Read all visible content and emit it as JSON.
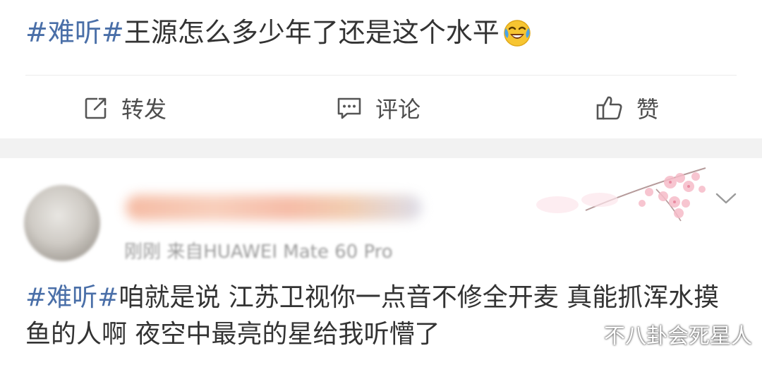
{
  "post": {
    "hashtag": "#难听#",
    "text": "王源怎么多少年了还是这个水平",
    "emoji_icon": "laughing-tears-emoji"
  },
  "actions": {
    "repost_label": "转发",
    "comment_label": "评论",
    "like_label": "赞"
  },
  "comment": {
    "meta": "刚刚 来自HUAWEI Mate 60 Pro",
    "hashtag": "#难听#",
    "text": "咱就是说 江苏卫视你一点音不修全开麦 真能抓浑水摸鱼的人啊 夜空中最亮的星给我听懵了"
  },
  "watermark": "不八卦会死星人",
  "colors": {
    "hashtag": "#4a6fa8",
    "text": "#333333",
    "separator": "#f2f2f2"
  }
}
